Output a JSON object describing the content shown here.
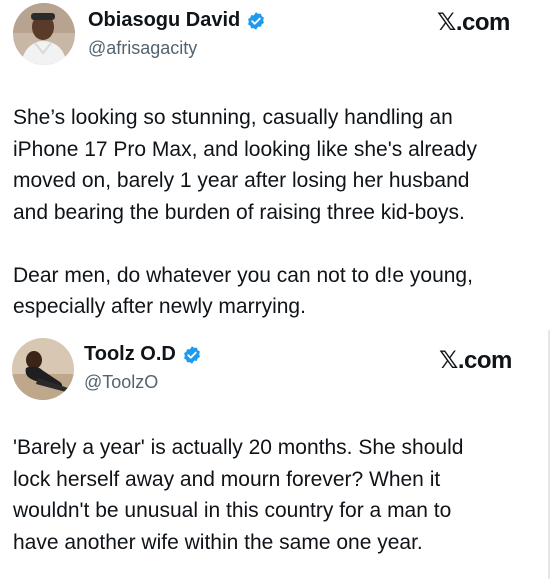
{
  "tweets": [
    {
      "author": {
        "name": "Obiasogu David",
        "handle": "@afrisagacity",
        "verified": true,
        "avatar_icon": "profile-photo-man"
      },
      "brand": "𝕏.com",
      "text": "She’s looking so stunning, casually handling an\niPhone 17 Pro Max, and looking like she's already\nmoved on, barely 1 year after losing her husband\nand bearing the burden of raising three kid-boys.\n\nDear men, do whatever you can not to d!e young,\nespecially after newly marrying."
    },
    {
      "author": {
        "name": "Toolz O.D",
        "handle": "@ToolzO",
        "verified": true,
        "avatar_icon": "profile-photo-woman"
      },
      "brand": "𝕏.com",
      "text": "'Barely a year' is actually 20 months. She should\nlock herself away and mourn forever? When it\nwouldn't be unusual in this country for a man to\nhave another wife within the same one year."
    }
  ],
  "colors": {
    "text": "#0f1419",
    "handle": "#536471",
    "verified": "#1d9bf0"
  }
}
